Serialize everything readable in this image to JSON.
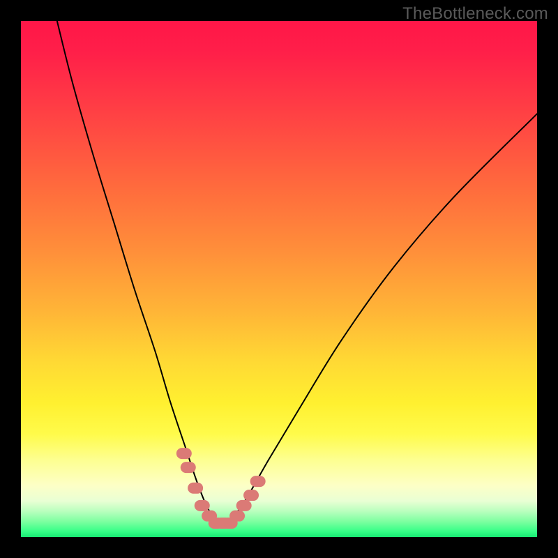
{
  "attribution": "TheBottleneck.com",
  "colors": {
    "frame": "#000000",
    "gradient_top": "#ff1648",
    "gradient_mid": "#ffd934",
    "gradient_bottom": "#18e873",
    "curve": "#000000",
    "markers": "#db7a76"
  },
  "chart_data": {
    "type": "line",
    "title": "",
    "xlabel": "",
    "ylabel": "",
    "xlim": [
      0,
      100
    ],
    "ylim": [
      0,
      100
    ],
    "note": "Axes are unlabeled; x/y in percent of plot area. y=0 at bottom (green), y=100 at top (red). Curve is a V-shaped bottleneck profile with minimum near x≈38.",
    "series": [
      {
        "name": "bottleneck-curve",
        "x": [
          7,
          10,
          14,
          18,
          22,
          26,
          29,
          32,
          34,
          36,
          38,
          40,
          42,
          44,
          48,
          54,
          62,
          72,
          84,
          100
        ],
        "y": [
          100,
          88,
          74,
          61,
          48,
          36,
          26,
          17,
          11,
          6,
          3,
          3,
          5,
          8,
          15,
          25,
          38,
          52,
          66,
          82
        ]
      }
    ],
    "markers": [
      {
        "x": 31.6,
        "y": 16.2
      },
      {
        "x": 32.4,
        "y": 13.5
      },
      {
        "x": 33.8,
        "y": 9.5
      },
      {
        "x": 35.1,
        "y": 6.1
      },
      {
        "x": 36.5,
        "y": 4.1
      },
      {
        "x": 37.8,
        "y": 2.7
      },
      {
        "x": 39.2,
        "y": 2.7
      },
      {
        "x": 40.5,
        "y": 2.7
      },
      {
        "x": 41.9,
        "y": 4.1
      },
      {
        "x": 43.2,
        "y": 6.1
      },
      {
        "x": 44.6,
        "y": 8.1
      },
      {
        "x": 45.9,
        "y": 10.8
      }
    ]
  }
}
